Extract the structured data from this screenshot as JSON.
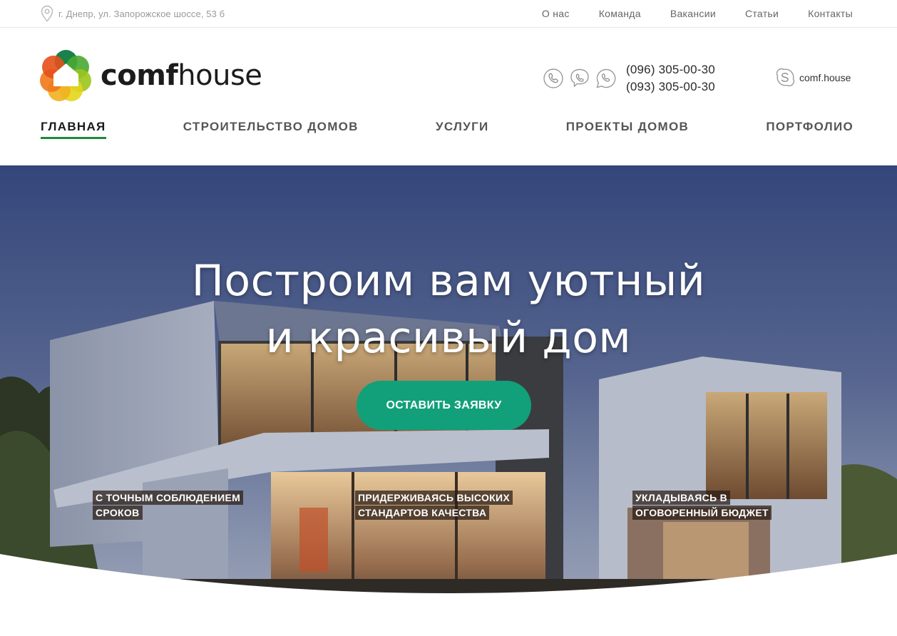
{
  "topbar": {
    "address": "г. Днепр, ул. Запорожское шоссе, 53 б",
    "links": [
      "О нас",
      "Команда",
      "Вакансии",
      "Статьи",
      "Контакты"
    ]
  },
  "logo": {
    "bold": "comf",
    "light": "house"
  },
  "contacts": {
    "phone1": "(096) 305-00-30",
    "phone2": "(093) 305-00-30",
    "skype": "comf.house",
    "icons": [
      "phone-icon",
      "viber-icon",
      "whatsapp-icon",
      "skype-icon"
    ]
  },
  "nav": {
    "items": [
      "ГЛАВНАЯ",
      "СТРОИТЕЛЬСТВО ДОМОВ",
      "УСЛУГИ",
      "ПРОЕКТЫ ДОМОВ",
      "ПОРТФОЛИО"
    ],
    "active": "ГЛАВНАЯ"
  },
  "hero": {
    "title_line1": "Построим вам уютный",
    "title_line2": "и красивый дом",
    "cta": "ОСТАВИТЬ ЗАЯВКУ",
    "features": [
      "С ТОЧНЫМ СОБЛЮДЕНИЕМ СРОКОВ",
      "ПРИДЕРЖИВАЯСЬ ВЫСОКИХ СТАНДАРТОВ КАЧЕСТВА",
      "УКЛАДЫВАЯСЬ В ОГОВОРЕННЫЙ БЮДЖЕТ"
    ]
  },
  "colors": {
    "accent": "#12a07a",
    "nav_active_underline": "#1e8a3a",
    "sky_top": "#3d4f7e",
    "sky_bottom": "#8a96b4"
  }
}
